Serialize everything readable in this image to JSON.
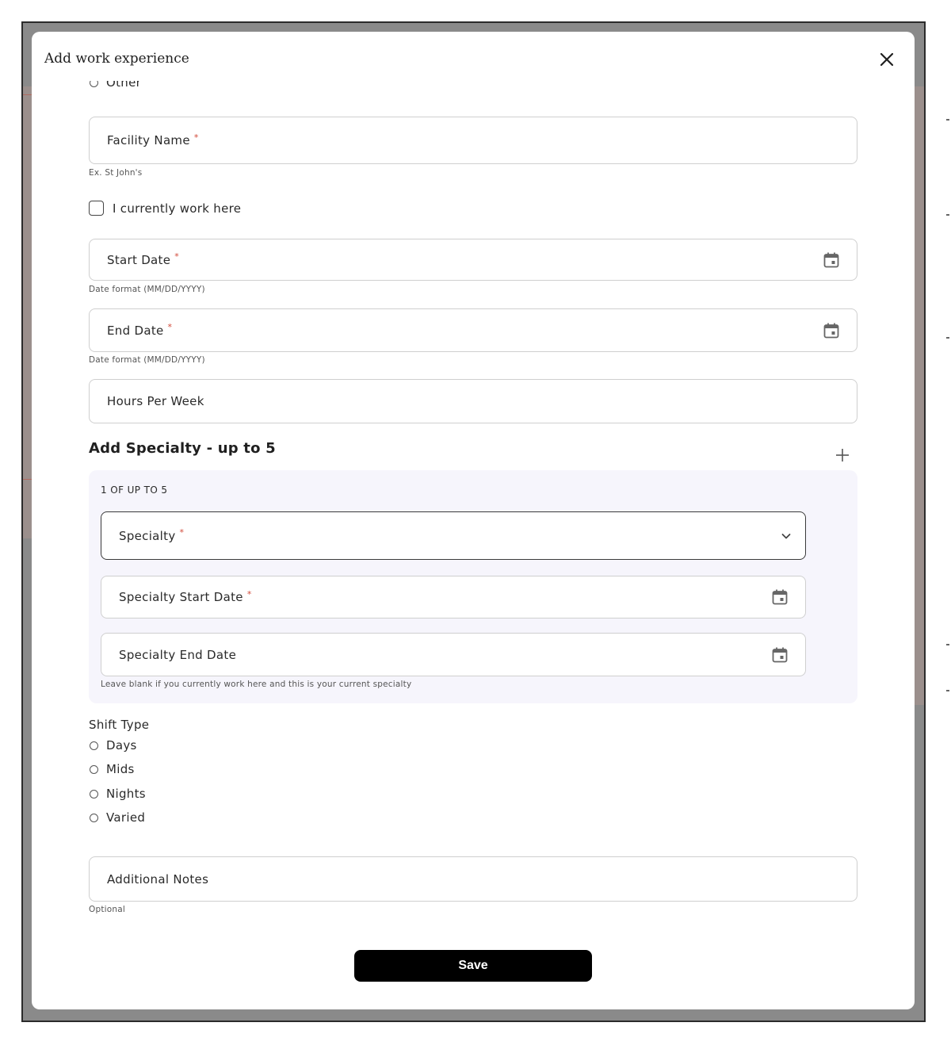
{
  "modal": {
    "title": "Add work experience",
    "close_icon": "close-icon"
  },
  "partial_radio": {
    "label": "Other"
  },
  "facility": {
    "label": "Facility Name",
    "required_mark": "*",
    "helper": "Ex. St John's"
  },
  "current_work": {
    "label": "I currently work here",
    "checked": false
  },
  "start_date": {
    "label": "Start Date",
    "required_mark": "*",
    "helper": "Date format (MM/DD/YYYY)",
    "icon": "calendar-icon"
  },
  "end_date": {
    "label": "End Date",
    "required_mark": "*",
    "helper": "Date format (MM/DD/YYYY)",
    "icon": "calendar-icon"
  },
  "hours": {
    "label": "Hours Per Week"
  },
  "specialty_section": {
    "title": "Add Specialty - up to 5",
    "add_icon": "plus-icon",
    "count_label": "1 OF UP TO 5",
    "specialty": {
      "label": "Specialty",
      "required_mark": "*",
      "icon": "chevron-down-icon"
    },
    "specialty_start": {
      "label": "Specialty Start Date",
      "required_mark": "*",
      "icon": "calendar-icon"
    },
    "specialty_end": {
      "label": "Specialty End Date",
      "icon": "calendar-icon"
    },
    "helper": "Leave blank if you currently work here and this is your current specialty"
  },
  "shift_type": {
    "label": "Shift Type",
    "options": [
      "Days",
      "Mids",
      "Nights",
      "Varied"
    ]
  },
  "notes": {
    "label": "Additional Notes",
    "helper": "Optional"
  },
  "save_label": "Save",
  "colors": {
    "required": "#d24a3a",
    "panel_bg": "#f6f5fc",
    "button_bg": "#000000"
  }
}
